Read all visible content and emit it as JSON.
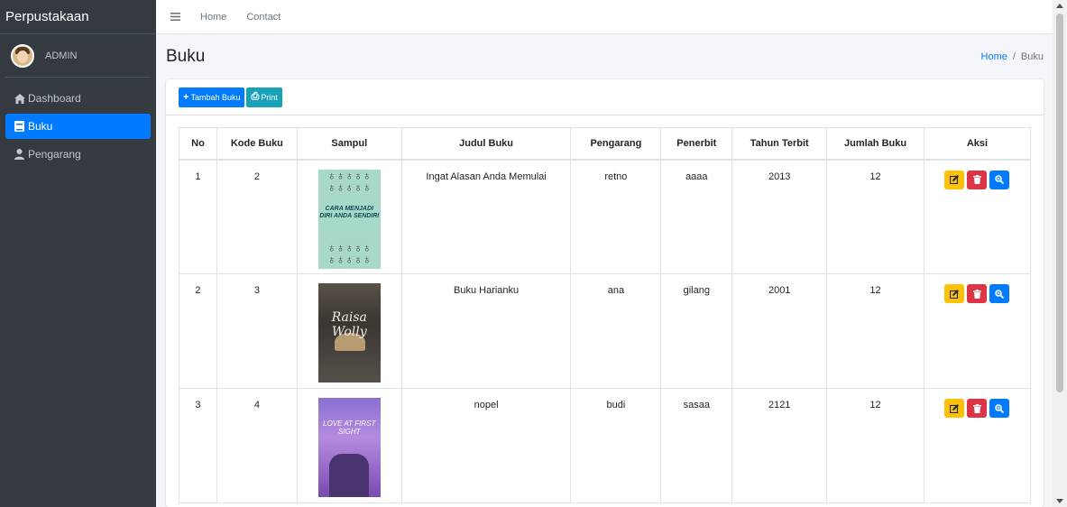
{
  "app": {
    "brand": "Perpustakaan"
  },
  "user": {
    "name": "ADMIN"
  },
  "sidebar": {
    "items": [
      {
        "label": "Dashboard",
        "icon": "home-icon"
      },
      {
        "label": "Buku",
        "icon": "book-icon",
        "active": true
      },
      {
        "label": "Pengarang",
        "icon": "user-icon"
      }
    ]
  },
  "topnav": {
    "home": "Home",
    "contact": "Contact"
  },
  "page": {
    "title": "Buku"
  },
  "breadcrumb": {
    "home": "Home",
    "separator": "/",
    "current": "Buku"
  },
  "toolbar": {
    "add_label": "Tambah Buku",
    "add_icon": "+",
    "print_label": "Print",
    "print_icon": "⎙"
  },
  "table": {
    "headers": [
      "No",
      "Kode Buku",
      "Sampul",
      "Judul Buku",
      "Pengarang",
      "Penerbit",
      "Tahun Terbit",
      "Jumlah Buku",
      "Aksi"
    ],
    "rows": [
      {
        "no": "1",
        "kode": "2",
        "judul": "Ingat Alasan Anda Memulai",
        "pengarang": "retno",
        "penerbit": "aaaa",
        "tahun": "2013",
        "jumlah": "12",
        "cover_text": "CARA MENJADI DIRI ANDA SENDIRI"
      },
      {
        "no": "2",
        "kode": "3",
        "judul": "Buku Harianku",
        "pengarang": "ana",
        "penerbit": "gilang",
        "tahun": "2001",
        "jumlah": "12",
        "cover_text": "Raisa Wolly"
      },
      {
        "no": "3",
        "kode": "4",
        "judul": "nopel",
        "pengarang": "budi",
        "penerbit": "sasaa",
        "tahun": "2121",
        "jumlah": "12",
        "cover_text": "LOVE AT FIRST SIGHT"
      }
    ]
  },
  "colors": {
    "primary": "#007bff",
    "info": "#17a2b8",
    "warning": "#ffc107",
    "danger": "#dc3545",
    "sidebar": "#343a40"
  }
}
